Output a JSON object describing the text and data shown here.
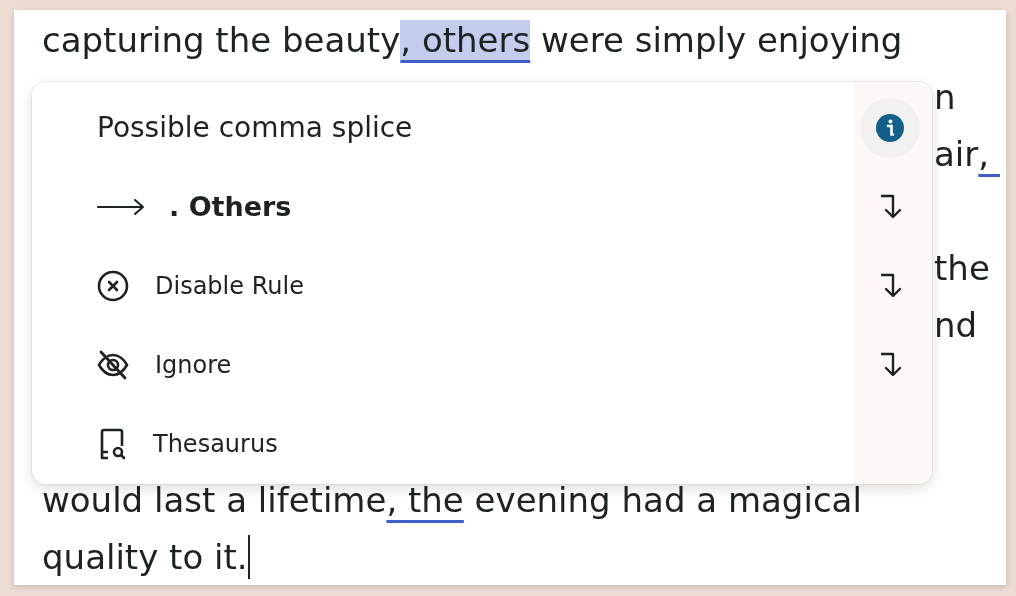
{
  "document": {
    "lines": [
      {
        "fragment": false,
        "caret": false,
        "segments": [
          {
            "kind": "plain",
            "text": "capturing the beauty"
          },
          {
            "kind": "active-issue",
            "text": ", others"
          },
          {
            "kind": "plain",
            "text": " were simply enjoying"
          }
        ]
      },
      {
        "fragment": true,
        "caret": false,
        "segments": [
          {
            "kind": "plain",
            "text": "n"
          }
        ]
      },
      {
        "fragment": true,
        "caret": false,
        "segments": [
          {
            "kind": "plain",
            "text": "air"
          },
          {
            "kind": "issue",
            "text": ", "
          }
        ]
      },
      {
        "fragment": true,
        "caret": false,
        "segments": [
          {
            "kind": "plain",
            "text": "the"
          }
        ]
      },
      {
        "fragment": true,
        "caret": false,
        "segments": [
          {
            "kind": "plain",
            "text": "nd"
          }
        ]
      },
      {
        "fragment": false,
        "caret": false,
        "segments": [
          {
            "kind": "plain",
            "text": "would last a lifetime"
          },
          {
            "kind": "issue",
            "text": ", the"
          },
          {
            "kind": "plain",
            "text": " evening had a magical"
          }
        ]
      },
      {
        "fragment": false,
        "caret": true,
        "segments": [
          {
            "kind": "plain",
            "text": "quality to it."
          }
        ]
      }
    ]
  },
  "popup": {
    "title": "Possible comma splice",
    "items": [
      {
        "kind": "suggestion",
        "label": ". Others",
        "enter_hint": true
      },
      {
        "kind": "disable",
        "label": "Disable Rule",
        "enter_hint": true
      },
      {
        "kind": "ignore",
        "label": "Ignore",
        "enter_hint": true
      },
      {
        "kind": "thesaurus",
        "label": "Thesaurus",
        "enter_hint": false
      }
    ]
  }
}
